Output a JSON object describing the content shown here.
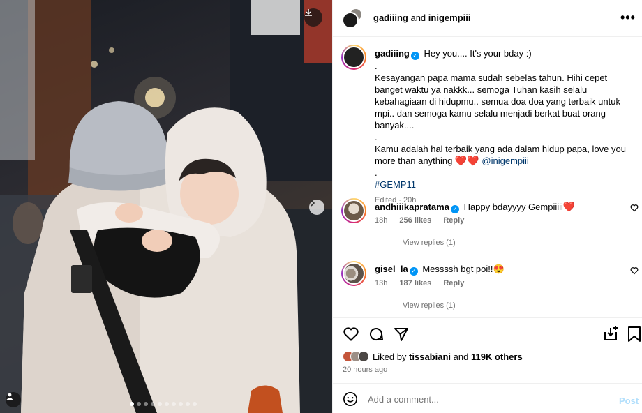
{
  "header": {
    "user1": "gadiiing",
    "connector": "and",
    "user2": "inigempiii"
  },
  "caption": {
    "username": "gadiiing",
    "line1": "Hey you.... It's your bday :)",
    "dot1": ".",
    "para1": "Kesayangan papa mama sudah sebelas tahun. Hihi cepet banget waktu ya nakkk... semoga Tuhan kasih selalu kebahagiaan di hidupmu.. semua doa doa yang terbaik untuk mpi.. dan semoga kamu selalu menjadi berkat buat orang banyak....",
    "dot2": ".",
    "para2": "Kamu adalah hal terbaik yang ada dalam hidup papa, love you more than anything",
    "hearts": "❤️❤️",
    "mention": "@inigempiii",
    "dot3": ".",
    "hashtag": "#GEMP11",
    "edited": "Edited",
    "sep": "·",
    "time": "20h"
  },
  "comments": [
    {
      "username": "andhiiikapratama",
      "text": "Happy bdayyyy Gempiiiii",
      "emoji": "❤️",
      "time": "18h",
      "likes": "256 likes",
      "reply": "Reply",
      "view_replies": "View replies (1)"
    },
    {
      "username": "gisel_la",
      "text": "Messssh bgt poi!!",
      "emoji": "😍",
      "time": "13h",
      "likes": "187 likes",
      "reply": "Reply",
      "view_replies": "View replies (1)"
    }
  ],
  "likes": {
    "prefix": "Liked by",
    "user": "tissabiani",
    "connector": "and",
    "others": "119K others"
  },
  "time_ago": "20 hours ago",
  "add_comment": {
    "placeholder": "Add a comment...",
    "post": "Post"
  },
  "carousel": {
    "count": 10,
    "active": 0
  },
  "colors": {
    "link": "#00376b",
    "verified": "#0095f6",
    "muted": "#737373",
    "post_disabled": "#b2dffc"
  }
}
